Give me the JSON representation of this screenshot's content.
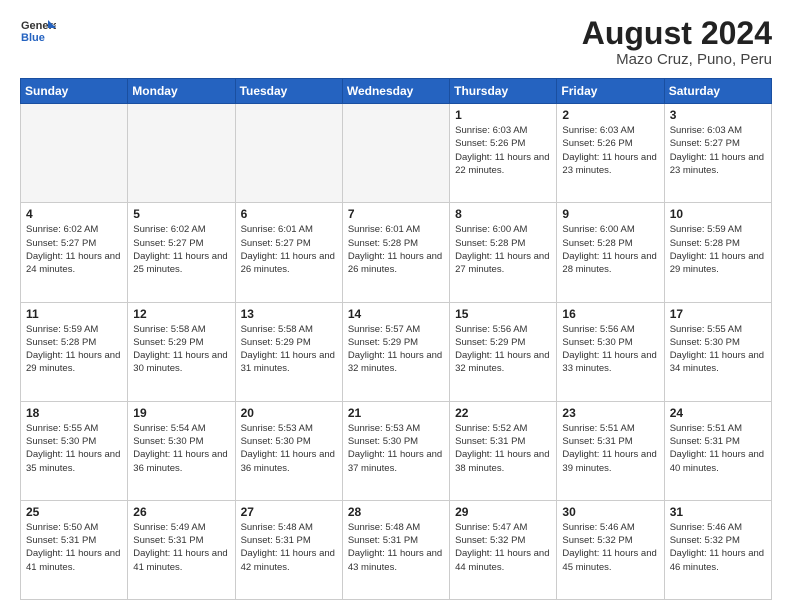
{
  "logo": {
    "general": "General",
    "blue": "Blue"
  },
  "title": "August 2024",
  "subtitle": "Mazo Cruz, Puno, Peru",
  "days_header": [
    "Sunday",
    "Monday",
    "Tuesday",
    "Wednesday",
    "Thursday",
    "Friday",
    "Saturday"
  ],
  "weeks": [
    [
      {
        "day": "",
        "info": ""
      },
      {
        "day": "",
        "info": ""
      },
      {
        "day": "",
        "info": ""
      },
      {
        "day": "",
        "info": ""
      },
      {
        "day": "1",
        "info": "Sunrise: 6:03 AM\nSunset: 5:26 PM\nDaylight: 11 hours and 22 minutes."
      },
      {
        "day": "2",
        "info": "Sunrise: 6:03 AM\nSunset: 5:26 PM\nDaylight: 11 hours and 23 minutes."
      },
      {
        "day": "3",
        "info": "Sunrise: 6:03 AM\nSunset: 5:27 PM\nDaylight: 11 hours and 23 minutes."
      }
    ],
    [
      {
        "day": "4",
        "info": "Sunrise: 6:02 AM\nSunset: 5:27 PM\nDaylight: 11 hours and 24 minutes."
      },
      {
        "day": "5",
        "info": "Sunrise: 6:02 AM\nSunset: 5:27 PM\nDaylight: 11 hours and 25 minutes."
      },
      {
        "day": "6",
        "info": "Sunrise: 6:01 AM\nSunset: 5:27 PM\nDaylight: 11 hours and 26 minutes."
      },
      {
        "day": "7",
        "info": "Sunrise: 6:01 AM\nSunset: 5:28 PM\nDaylight: 11 hours and 26 minutes."
      },
      {
        "day": "8",
        "info": "Sunrise: 6:00 AM\nSunset: 5:28 PM\nDaylight: 11 hours and 27 minutes."
      },
      {
        "day": "9",
        "info": "Sunrise: 6:00 AM\nSunset: 5:28 PM\nDaylight: 11 hours and 28 minutes."
      },
      {
        "day": "10",
        "info": "Sunrise: 5:59 AM\nSunset: 5:28 PM\nDaylight: 11 hours and 29 minutes."
      }
    ],
    [
      {
        "day": "11",
        "info": "Sunrise: 5:59 AM\nSunset: 5:28 PM\nDaylight: 11 hours and 29 minutes."
      },
      {
        "day": "12",
        "info": "Sunrise: 5:58 AM\nSunset: 5:29 PM\nDaylight: 11 hours and 30 minutes."
      },
      {
        "day": "13",
        "info": "Sunrise: 5:58 AM\nSunset: 5:29 PM\nDaylight: 11 hours and 31 minutes."
      },
      {
        "day": "14",
        "info": "Sunrise: 5:57 AM\nSunset: 5:29 PM\nDaylight: 11 hours and 32 minutes."
      },
      {
        "day": "15",
        "info": "Sunrise: 5:56 AM\nSunset: 5:29 PM\nDaylight: 11 hours and 32 minutes."
      },
      {
        "day": "16",
        "info": "Sunrise: 5:56 AM\nSunset: 5:30 PM\nDaylight: 11 hours and 33 minutes."
      },
      {
        "day": "17",
        "info": "Sunrise: 5:55 AM\nSunset: 5:30 PM\nDaylight: 11 hours and 34 minutes."
      }
    ],
    [
      {
        "day": "18",
        "info": "Sunrise: 5:55 AM\nSunset: 5:30 PM\nDaylight: 11 hours and 35 minutes."
      },
      {
        "day": "19",
        "info": "Sunrise: 5:54 AM\nSunset: 5:30 PM\nDaylight: 11 hours and 36 minutes."
      },
      {
        "day": "20",
        "info": "Sunrise: 5:53 AM\nSunset: 5:30 PM\nDaylight: 11 hours and 36 minutes."
      },
      {
        "day": "21",
        "info": "Sunrise: 5:53 AM\nSunset: 5:30 PM\nDaylight: 11 hours and 37 minutes."
      },
      {
        "day": "22",
        "info": "Sunrise: 5:52 AM\nSunset: 5:31 PM\nDaylight: 11 hours and 38 minutes."
      },
      {
        "day": "23",
        "info": "Sunrise: 5:51 AM\nSunset: 5:31 PM\nDaylight: 11 hours and 39 minutes."
      },
      {
        "day": "24",
        "info": "Sunrise: 5:51 AM\nSunset: 5:31 PM\nDaylight: 11 hours and 40 minutes."
      }
    ],
    [
      {
        "day": "25",
        "info": "Sunrise: 5:50 AM\nSunset: 5:31 PM\nDaylight: 11 hours and 41 minutes."
      },
      {
        "day": "26",
        "info": "Sunrise: 5:49 AM\nSunset: 5:31 PM\nDaylight: 11 hours and 41 minutes."
      },
      {
        "day": "27",
        "info": "Sunrise: 5:48 AM\nSunset: 5:31 PM\nDaylight: 11 hours and 42 minutes."
      },
      {
        "day": "28",
        "info": "Sunrise: 5:48 AM\nSunset: 5:31 PM\nDaylight: 11 hours and 43 minutes."
      },
      {
        "day": "29",
        "info": "Sunrise: 5:47 AM\nSunset: 5:32 PM\nDaylight: 11 hours and 44 minutes."
      },
      {
        "day": "30",
        "info": "Sunrise: 5:46 AM\nSunset: 5:32 PM\nDaylight: 11 hours and 45 minutes."
      },
      {
        "day": "31",
        "info": "Sunrise: 5:46 AM\nSunset: 5:32 PM\nDaylight: 11 hours and 46 minutes."
      }
    ]
  ]
}
